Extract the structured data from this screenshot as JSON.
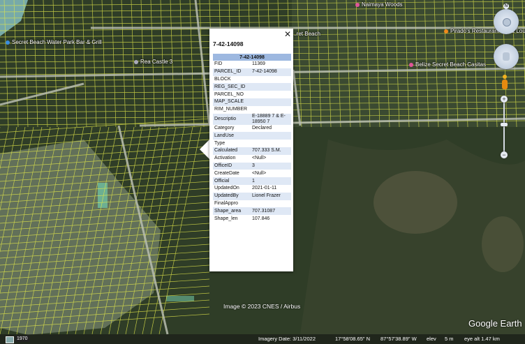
{
  "map": {
    "colors": {
      "dense_veg": "#2f3d27",
      "clearing": "#8d9a84",
      "road": "#b9bdb0",
      "parcel": "#e2e84a",
      "sea": "#7fb6b8"
    },
    "places": [
      {
        "name": "Secret Beach Water Park Bar & Grill",
        "icon": "blue-pin"
      },
      {
        "name": "Rea Castle 3",
        "icon": "grey-pin"
      },
      {
        "name": "Naimaya Woods",
        "icon": "pink-pin"
      },
      {
        "name": "...ret Beach",
        "icon": ""
      },
      {
        "name": "Pirado's Restaurant Bar & Lou...",
        "icon": "orange-pin"
      },
      {
        "name": "Belize Secret Beach Casitas",
        "icon": "pink-pin"
      }
    ],
    "credit": "Image © 2023 CNES / Airbus",
    "logo": "Google Earth"
  },
  "popup": {
    "title": "7-42-14098",
    "table_header": "7-42-14098",
    "close_label": "✕",
    "rows": [
      {
        "key": "FID",
        "value": "11369"
      },
      {
        "key": "PARCEL_ID",
        "value": "7-42-14098"
      },
      {
        "key": "BLOCK",
        "value": ""
      },
      {
        "key": "REG_SEC_ID",
        "value": ""
      },
      {
        "key": "PARCEL_NO",
        "value": ""
      },
      {
        "key": "MAP_SCALE",
        "value": ""
      },
      {
        "key": "RIM_NUMBER",
        "value": ""
      },
      {
        "key": "Descriptio",
        "value": "E-18889 7 & E-18950 7"
      },
      {
        "key": "Category",
        "value": "Declared"
      },
      {
        "key": "LandUse",
        "value": ""
      },
      {
        "key": "Type",
        "value": ""
      },
      {
        "key": "Calculated",
        "value": "707.333 S.M."
      },
      {
        "key": "Activation",
        "value": "<Null>"
      },
      {
        "key": "OfficeID",
        "value": "3"
      },
      {
        "key": "CreateDate",
        "value": "<Null>"
      },
      {
        "key": "Official",
        "value": "1"
      },
      {
        "key": "UpdatedOn",
        "value": "2021-01-11"
      },
      {
        "key": "UpdatedBy",
        "value": "Lionel Frazer"
      },
      {
        "key": "FinalAppro",
        "value": ""
      },
      {
        "key": "Shape_area",
        "value": "707.31087"
      },
      {
        "key": "Shape_len",
        "value": "107.846"
      }
    ]
  },
  "nav": {
    "north_label": "N",
    "zoom_in": "+",
    "zoom_out": "−"
  },
  "status": {
    "year": "1970",
    "imagery_date": "Imagery Date: 3/11/2022",
    "lat": "17°58'08.65\" N",
    "lon": "87°57'38.89\" W",
    "elev_label": "elev",
    "elev_value": "5 m",
    "eye_alt": "eye alt  1.47 km"
  }
}
